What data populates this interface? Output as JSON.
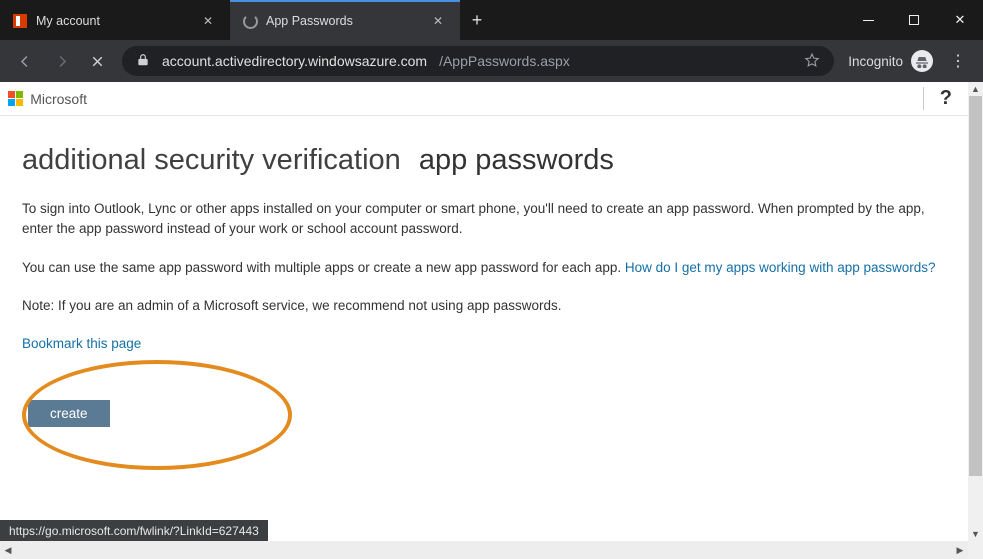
{
  "browser": {
    "tabs": [
      {
        "title": "My account"
      },
      {
        "title": "App Passwords"
      }
    ],
    "new_tab_tooltip": "+",
    "window_controls": {
      "minimize": "−",
      "maximize": "▢",
      "close": "✕"
    },
    "nav": {
      "stop_tooltip": "Stop",
      "back_tooltip": "Back",
      "forward_tooltip": "Forward"
    },
    "address": {
      "lock_tooltip": "Secure",
      "host": "account.activedirectory.windowsazure.com",
      "path": "/AppPasswords.aspx"
    },
    "bookmark_star_tooltip": "Bookmark",
    "incognito_label": "Incognito",
    "menu_tooltip": "⋮"
  },
  "page": {
    "brand": "Microsoft",
    "help_glyph": "?",
    "heading_main": "additional security verification",
    "heading_sub": "app passwords",
    "para1": "To sign into Outlook, Lync or other apps installed on your computer or smart phone, you'll need to create an app password. When prompted by the app, enter the app password instead of your work or school account password.",
    "para2_prefix": "You can use the same app password with multiple apps or create a new app password for each app. ",
    "para2_link": "How do I get my apps working with app passwords?",
    "para3": "Note: If you are an admin of a Microsoft service, we recommend not using app passwords.",
    "bookmark_link": "Bookmark this page",
    "create_button": "create",
    "status_url": "https://go.microsoft.com/fwlink/?LinkId=627443"
  }
}
